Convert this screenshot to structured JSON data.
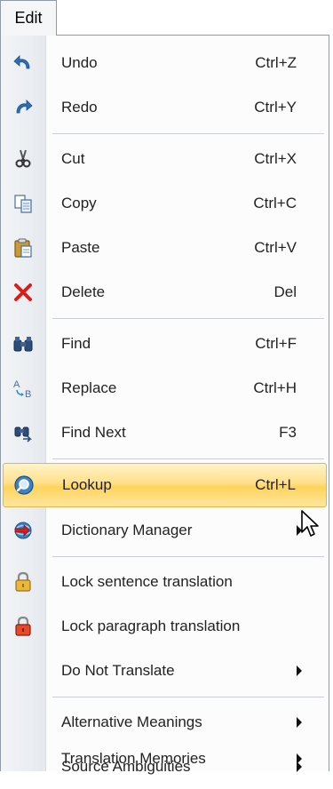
{
  "menu_bar": {
    "edit_label": "Edit"
  },
  "menu": {
    "items": [
      {
        "label": "Undo",
        "shortcut": "Ctrl+Z",
        "icon": "undo-icon"
      },
      {
        "label": "Redo",
        "shortcut": "Ctrl+Y",
        "icon": "redo-icon"
      },
      {
        "label": "Cut",
        "shortcut": "Ctrl+X",
        "icon": "cut-icon"
      },
      {
        "label": "Copy",
        "shortcut": "Ctrl+C",
        "icon": "copy-icon"
      },
      {
        "label": "Paste",
        "shortcut": "Ctrl+V",
        "icon": "paste-icon"
      },
      {
        "label": "Delete",
        "shortcut": "Del",
        "icon": "delete-icon"
      },
      {
        "label": "Find",
        "shortcut": "Ctrl+F",
        "icon": "find-icon"
      },
      {
        "label": "Replace",
        "shortcut": "Ctrl+H",
        "icon": "replace-icon"
      },
      {
        "label": "Find Next",
        "shortcut": "F3",
        "icon": "find-next-icon"
      },
      {
        "label": "Lookup",
        "shortcut": "Ctrl+L",
        "icon": "lookup-icon",
        "highlighted": true
      },
      {
        "label": "Dictionary Manager",
        "icon": "dictionary-manager-icon",
        "submenu": true
      },
      {
        "label": "Lock sentence translation",
        "icon": "lock-icon"
      },
      {
        "label": "Lock paragraph translation",
        "icon": "lock-red-icon"
      },
      {
        "label": "Do Not Translate",
        "submenu": true
      },
      {
        "label": "Alternative Meanings",
        "submenu": true
      },
      {
        "label": "Source Ambiguities",
        "submenu": true
      },
      {
        "label": "Translation Memories",
        "submenu": true
      }
    ]
  },
  "colors": {
    "highlight_fill": "#ffd35c",
    "highlight_border": "#e5b44b",
    "delete_red": "#d91c1c",
    "icon_blue": "#2c6fb7"
  }
}
